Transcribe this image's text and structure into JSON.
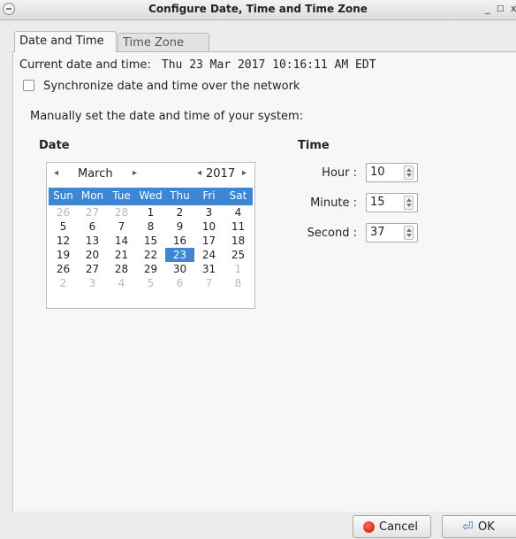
{
  "window": {
    "title": "Configure Date, Time and Time Zone",
    "minimize_glyph": "_",
    "maximize_glyph": "□",
    "close_glyph": "x"
  },
  "tabs": [
    {
      "label": "Date and Time",
      "active": true
    },
    {
      "label": "Time Zone",
      "active": false
    }
  ],
  "current": {
    "label": "Current date and time:",
    "value": "Thu 23 Mar 2017 10:16:11 AM EDT"
  },
  "sync": {
    "label": "Synchronize date and time over the network",
    "checked": false
  },
  "manual_label": "Manually set the date and time of your system:",
  "date_section": {
    "title": "Date",
    "month": "March",
    "year": "2017",
    "prev_month_icon": "◂",
    "next_month_icon": "▸",
    "prev_year_icon": "◂",
    "next_year_icon": "▸",
    "weekdays": [
      "Sun",
      "Mon",
      "Tue",
      "Wed",
      "Thu",
      "Fri",
      "Sat"
    ],
    "weeks": [
      [
        "26",
        "27",
        "28",
        "1",
        "2",
        "3",
        "4"
      ],
      [
        "5",
        "6",
        "7",
        "8",
        "9",
        "10",
        "11"
      ],
      [
        "12",
        "13",
        "14",
        "15",
        "16",
        "17",
        "18"
      ],
      [
        "19",
        "20",
        "21",
        "22",
        "23",
        "24",
        "25"
      ],
      [
        "26",
        "27",
        "28",
        "29",
        "30",
        "31",
        "1"
      ],
      [
        "2",
        "3",
        "4",
        "5",
        "6",
        "7",
        "8"
      ]
    ],
    "selected_day": "23",
    "accent_color": "#3c86d4"
  },
  "time_section": {
    "title": "Time",
    "hour_label": "Hour :",
    "hour": "10",
    "minute_label": "Minute :",
    "minute": "15",
    "second_label": "Second :",
    "second": "37"
  },
  "buttons": {
    "cancel": "Cancel",
    "ok": "OK"
  }
}
